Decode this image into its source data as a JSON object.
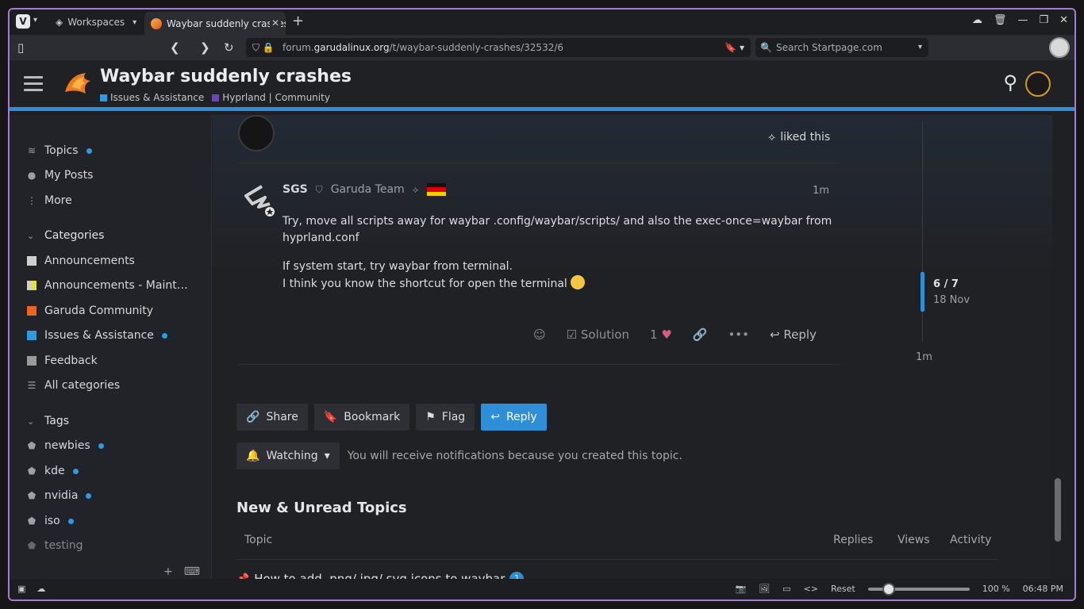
{
  "browser": {
    "workspaces_label": "Workspaces",
    "tab_title": "Waybar suddenly crashes - I",
    "url_prefix": "forum.",
    "url_host": "garudalinux.org",
    "url_path": "/t/waybar-suddenly-crashes/32532/6",
    "search_placeholder": "Search Startpage.com"
  },
  "forum": {
    "title": "Waybar suddenly crashes",
    "categories": [
      {
        "label": "Issues & Assistance",
        "color": "#2d9be3"
      },
      {
        "label": "Hyprland | Community",
        "color": "#6b44c2"
      }
    ]
  },
  "sidebar": {
    "nav": [
      {
        "label": "Topics",
        "icon": "layers-icon",
        "dot": true
      },
      {
        "label": "My Posts",
        "icon": "user-icon",
        "dot": false
      },
      {
        "label": "More",
        "icon": "more-vertical-icon",
        "dot": false
      }
    ],
    "categories_heading": "Categories",
    "categories": [
      {
        "label": "Announcements",
        "color": "#cfcfcf"
      },
      {
        "label": "Announcements - Maint…",
        "color": "#e8e032"
      },
      {
        "label": "Garuda Community",
        "color": "#f26322"
      },
      {
        "label": "Issues & Assistance",
        "color": "#2d9be3",
        "dot": true
      },
      {
        "label": "Feedback",
        "color": "#9a9a9a"
      },
      {
        "label": "All categories",
        "color": ""
      }
    ],
    "tags_heading": "Tags",
    "tags": [
      {
        "label": "newbies",
        "dot": true
      },
      {
        "label": "kde",
        "dot": true
      },
      {
        "label": "nvidia",
        "dot": true
      },
      {
        "label": "iso",
        "dot": true
      },
      {
        "label": "testing",
        "dot": false
      }
    ]
  },
  "post": {
    "liked_text": "liked this",
    "username": "SGS",
    "group": "Garuda Team",
    "time": "1m",
    "body_line1": "Try, move all scripts away for waybar .config/waybar/scripts/ and also the exec-once=waybar from hyprland.conf",
    "body_line2": "If system start, try waybar from terminal.",
    "body_line3": "I think you know the shortcut for open the terminal",
    "solution_label": "Solution",
    "like_count": "1",
    "reply_label": "Reply"
  },
  "timeline": {
    "position": "6 / 7",
    "date": "18 Nov",
    "bottom": "1m"
  },
  "footer_buttons": {
    "share": "Share",
    "bookmark": "Bookmark",
    "flag": "Flag",
    "reply": "Reply"
  },
  "notification": {
    "level": "Watching",
    "text": "You will receive notifications because you created this topic."
  },
  "new_unread": {
    "title": "New & Unread Topics",
    "columns": [
      "Topic",
      "Replies",
      "Views",
      "Activity"
    ],
    "first_topic": "How to add .png/.jpg/.svg icons to waybar",
    "first_topic_badge": "1"
  },
  "statusbar": {
    "reset_label": "Reset",
    "zoom": "100 %",
    "clock": "06:48 PM"
  }
}
